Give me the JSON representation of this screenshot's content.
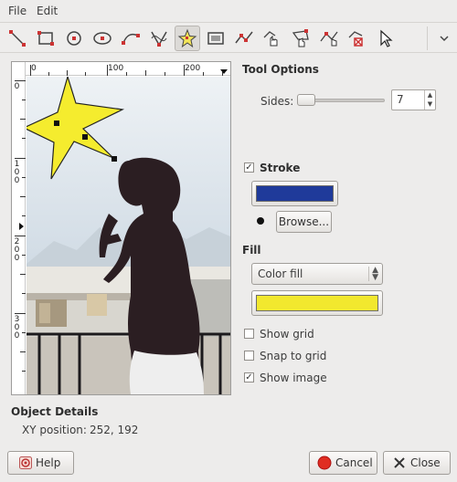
{
  "menu": {
    "file": "File",
    "edit": "Edit"
  },
  "toolbar": {
    "tools": [
      "line",
      "rectangle",
      "circle",
      "ellipse",
      "arc",
      "bezier",
      "star",
      "image",
      "polyline",
      "polyline-move",
      "polygon-edit",
      "polyline-point",
      "delete",
      "pointer"
    ]
  },
  "preview": {
    "h_ruler": [
      "0",
      "100",
      "200"
    ],
    "v_ruler": [
      "0",
      "100",
      "200",
      "300"
    ]
  },
  "tool_options": {
    "title": "Tool Options",
    "sides_label": "Sides:",
    "sides_value": "7",
    "sides_fraction": 0.0
  },
  "stroke": {
    "label": "Stroke",
    "checked": true,
    "color": "#1f3a9a",
    "browse_label": "Browse..."
  },
  "fill": {
    "title": "Fill",
    "type": "Color fill",
    "color": "#f2e82e"
  },
  "options": {
    "show_grid": "Show grid",
    "snap_to_grid": "Snap to grid",
    "show_image": "Show image",
    "show_grid_checked": false,
    "snap_checked": false,
    "show_image_checked": true
  },
  "object_details": {
    "title": "Object Details",
    "xy_label": "XY position:",
    "xy_value": "252, 192"
  },
  "buttons": {
    "help": "Help",
    "cancel": "Cancel",
    "close": "Close"
  }
}
